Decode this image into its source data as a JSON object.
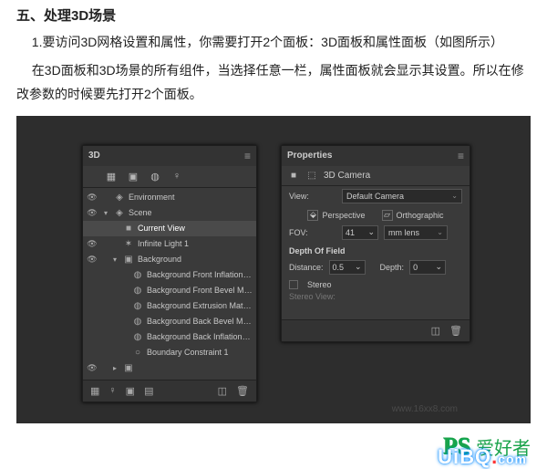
{
  "article": {
    "heading": "五、处理3D场景",
    "p1": "1.要访问3D网格设置和属性，你需要打开2个面板：3D面板和属性面板（如图所示）",
    "p2": "在3D面板和3D场景的所有组件，当选择任意一栏，属性面板就会显示其设置。所以在修改参数的时候要先打开2个面板。"
  },
  "threeD": {
    "title": "3D",
    "tree": [
      {
        "eye": "👁",
        "tw": "",
        "icon": "◈",
        "label": "Environment",
        "depth": 0,
        "sel": false
      },
      {
        "eye": "👁",
        "tw": "▾",
        "icon": "◈",
        "label": "Scene",
        "depth": 0,
        "sel": false
      },
      {
        "eye": "",
        "tw": "",
        "icon": "■",
        "label": "Current View",
        "depth": 1,
        "sel": true
      },
      {
        "eye": "👁",
        "tw": "",
        "icon": "✶",
        "label": "Infinite Light 1",
        "depth": 1,
        "sel": false
      },
      {
        "eye": "👁",
        "tw": "▾",
        "icon": "▣",
        "label": "Background",
        "depth": 1,
        "sel": false
      },
      {
        "eye": "",
        "tw": "",
        "icon": "◍",
        "label": "Background Front Inflation …",
        "depth": 2,
        "sel": false
      },
      {
        "eye": "",
        "tw": "",
        "icon": "◍",
        "label": "Background Front Bevel Ma…",
        "depth": 2,
        "sel": false
      },
      {
        "eye": "",
        "tw": "",
        "icon": "◍",
        "label": "Background Extrusion Mate…",
        "depth": 2,
        "sel": false
      },
      {
        "eye": "",
        "tw": "",
        "icon": "◍",
        "label": "Background Back Bevel Mat…",
        "depth": 2,
        "sel": false
      },
      {
        "eye": "",
        "tw": "",
        "icon": "◍",
        "label": "Background Back Inflation …",
        "depth": 2,
        "sel": false
      },
      {
        "eye": "",
        "tw": "",
        "icon": "○",
        "label": "Boundary Constraint 1",
        "depth": 2,
        "sel": false
      },
      {
        "eye": "👁",
        "tw": "▸",
        "icon": "▣",
        "label": "",
        "depth": 1,
        "sel": false
      }
    ]
  },
  "properties": {
    "title": "Properties",
    "subtitle": "3D Camera",
    "view_label": "View:",
    "view_value": "Default Camera",
    "perspective": "Perspective",
    "orthographic": "Orthographic",
    "fov_label": "FOV:",
    "fov_value": "41",
    "fov_unit": "mm lens",
    "dof_title": "Depth Of Field",
    "distance_label": "Distance:",
    "distance_value": "0.5",
    "depth_label": "Depth:",
    "depth_value": "0",
    "stereo": "Stereo",
    "stereo_view": "Stereo View:"
  },
  "watermarks": {
    "url": "www.16xx8.com",
    "brand1": "PS",
    "brand2": "爱好者",
    "uibq": "UiBQ",
    "com": "com"
  }
}
